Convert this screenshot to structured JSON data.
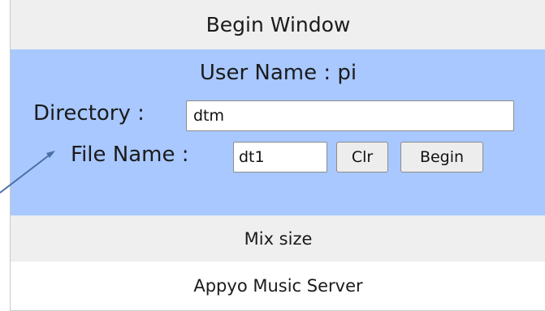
{
  "header": {
    "title": "Begin Window"
  },
  "form": {
    "user_line": "User Name : pi",
    "directory_label": "Directory :",
    "directory_value": "dtm",
    "file_name_label": "File Name :",
    "file_name_value": "dt1",
    "clear_button": "Clr",
    "begin_button": "Begin"
  },
  "mix_size": {
    "label": "Mix size"
  },
  "footer": {
    "text": "Appyo Music Server"
  },
  "colors": {
    "panel_blue": "#a8c8ff",
    "header_gray": "#efefef",
    "annotation_arrow": "#4a6fa8"
  }
}
